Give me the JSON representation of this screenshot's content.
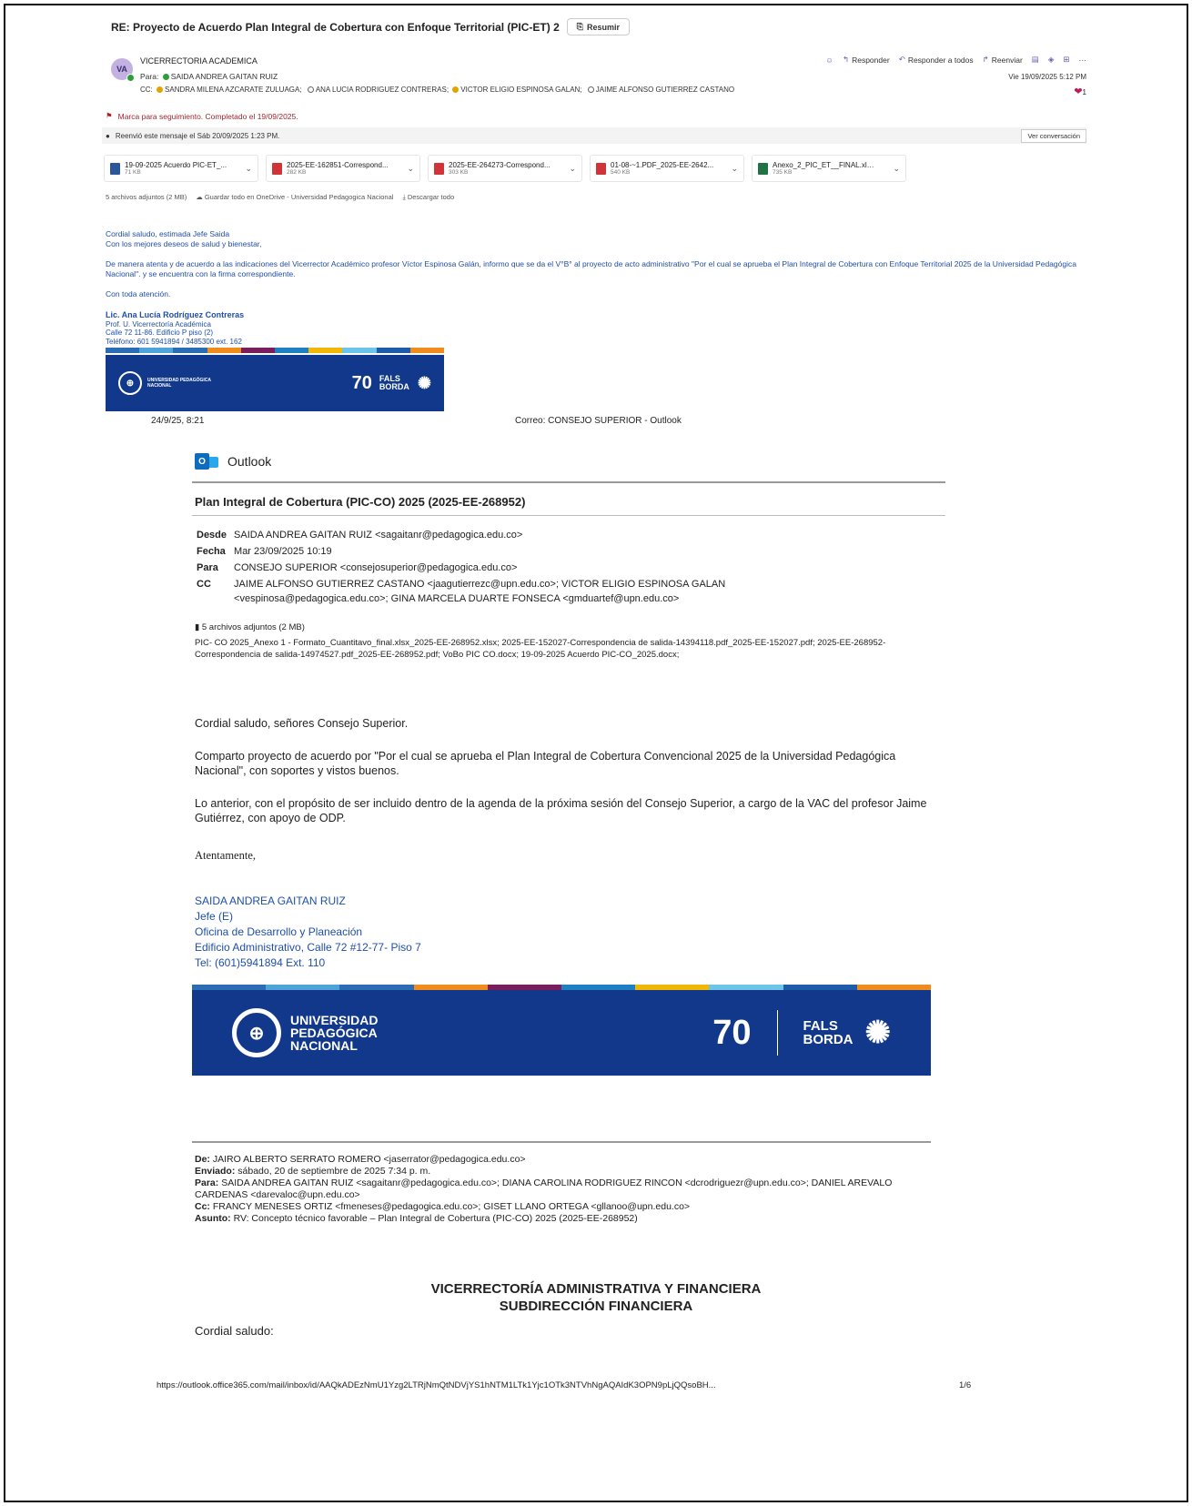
{
  "email": {
    "subject": "RE: Proyecto de Acuerdo  Plan Integral de Cobertura con Enfoque Territorial (PIC-ET) 2",
    "resumir": "Resumir",
    "avatar": "VA",
    "sender": "VICERRECTORIA ACADEMICA",
    "to_label": "Para:",
    "to": "SAIDA ANDREA GAITAN RUIZ",
    "cc_label": "CC:",
    "cc": [
      "SANDRA MILENA AZCARATE ZULUAGA;",
      "ANA LUCIA RODRIGUEZ CONTRERAS;",
      "VICTOR ELIGIO ESPINOSA GALAN;",
      "JAIME ALFONSO GUTIERREZ CASTANO"
    ],
    "actions": {
      "reply": "Responder",
      "reply_all": "Responder a todos",
      "forward": "Reenviar",
      "more": "···"
    },
    "date": "Vie 19/09/2025 5:12 PM",
    "reaction_count": "1",
    "flag_text": "Marca para seguimiento. Completado el 19/09/2025.",
    "forward_note": "Reenvió este mensaje el Sáb 20/09/2025 1:23 PM.",
    "ver_conversacion": "Ver conversación",
    "attachments": [
      {
        "name": "19-09-2025 Acuerdo PIC-ET_...",
        "size": "71 KB",
        "type": "word",
        "color": "#2b579a"
      },
      {
        "name": "2025-EE-162851-Correspond...",
        "size": "282 KB",
        "type": "pdf",
        "color": "#d13438"
      },
      {
        "name": "2025-EE-264273-Correspond...",
        "size": "303 KB",
        "type": "pdf",
        "color": "#d13438"
      },
      {
        "name": "01-08-~1.PDF_2025-EE-2642...",
        "size": "540 KB",
        "type": "pdf",
        "color": "#d13438"
      },
      {
        "name": "Anexo_2_PIC_ET__FINAL.xlsx_...",
        "size": "735 KB",
        "type": "excel",
        "color": "#217346"
      }
    ],
    "att_summary": "5 archivos adjuntos (2 MB)",
    "save_onedrive": "Guardar todo en OneDrive - Universidad Pedagogica Nacional",
    "download_all": "Descargar todo",
    "body": [
      "Cordial saludo, estimada Jefe Saida",
      "Con los mejores deseos de salud y bienestar,",
      "",
      "De manera atenta y de acuerdo a las indicaciones del Vicerrector Académico profesor Víctor Espinosa Galán, informo que se da el V°B° al proyecto de acto administrativo \"Por el cual se aprueba el Plan Integral de Cobertura con Enfoque Territorial 2025 de la Universidad Pedagógica Nacional\". y se encuentra con la firma correspondiente.",
      "",
      "Con toda atención."
    ],
    "signature": {
      "name": "Lic. Ana Lucía Rodríguez Contreras",
      "lines": [
        "Prof. U. Vicerrectoría Académica",
        "Calle 72 11-86. Edificio P piso (2)",
        "Teléfono: 601 5941894 / 3485300 ext. 162"
      ]
    },
    "banner": {
      "uni": [
        "UNIVERSIDAD PEDAGÓGICA",
        "NACIONAL"
      ],
      "seventy": "70",
      "fals": "FALS BORDA"
    }
  },
  "pdf": {
    "print_date": "24/9/25, 8:21",
    "print_title": "Correo: CONSEJO SUPERIOR - Outlook",
    "app": "Outlook",
    "title": "Plan Integral de Cobertura (PIC-CO) 2025 (2025-EE-268952)",
    "meta": {
      "desde_l": "Desde",
      "desde": "SAIDA ANDREA GAITAN RUIZ <sagaitanr@pedagogica.edu.co>",
      "fecha_l": "Fecha",
      "fecha": "Mar 23/09/2025 10:19",
      "para_l": "Para",
      "para": "CONSEJO SUPERIOR <consejosuperior@pedagogica.edu.co>",
      "cc_l": "CC",
      "cc": "JAIME ALFONSO GUTIERREZ CASTANO <jaagutierrezc@upn.edu.co>; VICTOR ELIGIO ESPINOSA GALAN <vespinosa@pedagogica.edu.co>; GINA MARCELA DUARTE FONSECA <gmduartef@upn.edu.co>"
    },
    "attach_count": "5 archivos adjuntos (2 MB)",
    "attach_list": "PIC- CO 2025_Anexo 1 - Formato_Cuantitavo_final.xlsx_2025-EE-268952.xlsx; 2025-EE-152027-Correspondencia de salida-14394118.pdf_2025-EE-152027.pdf; 2025-EE-268952-Correspondencia de salida-14974527.pdf_2025-EE-268952.pdf; VoBo PIC CO.docx; 19-09-2025 Acuerdo PIC-CO_2025.docx;",
    "body": [
      "Cordial saludo, señores Consejo Superior.",
      "Comparto proyecto de acuerdo por \"Por el cual se aprueba el Plan Integral de Cobertura Convencional 2025 de la Universidad Pedagógica Nacional\", con soportes y vistos buenos.",
      "Lo anterior, con el propósito de ser incluido dentro de la agenda de la próxima sesión del Consejo Superior, a cargo de la VAC del profesor Jaime Gutiérrez, con apoyo de ODP."
    ],
    "closing": "Atentamente,",
    "signature": [
      "SAIDA ANDREA GAITAN RUIZ",
      "Jefe (E)",
      "Oficina de Desarrollo y Planeación",
      "Edificio Administrativo, Calle 72 #12-77- Piso 7",
      "Tel: (601)5941894 Ext. 110"
    ],
    "banner": {
      "uni": [
        "UNIVERSIDAD",
        "PEDAGÓGICA",
        "NACIONAL"
      ],
      "seventy": "70",
      "fals": "FALS BORDA"
    },
    "fwd": {
      "de_l": "De:",
      "de": "JAIRO ALBERTO SERRATO ROMERO <jaserrator@pedagogica.edu.co>",
      "env_l": "Enviado:",
      "env": "sábado, 20 de septiembre de 2025 7:34 p. m.",
      "para_l": "Para:",
      "para": "SAIDA ANDREA GAITAN RUIZ <sagaitanr@pedagogica.edu.co>; DIANA CAROLINA RODRIGUEZ RINCON <dcrodriguezr@upn.edu.co>; DANIEL AREVALO CARDENAS <darevaloc@upn.edu.co>",
      "cc_l": "Cc:",
      "cc": "FRANCY MENESES ORTIZ <fmeneses@pedagogica.edu.co>; GISET LLANO ORTEGA <gllanoo@upn.edu.co>",
      "asunto_l": "Asunto:",
      "asunto": "RV: Concepto técnico favorable – Plan Integral de Cobertura (PIC-CO) 2025 (2025-EE-268952)"
    },
    "heading1": "VICERRECTORÍA ADMINISTRATIVA Y FINANCIERA",
    "heading2": "SUBDIRECCIÓN FINANCIERA",
    "cordial": "Cordial saludo:",
    "url": "https://outlook.office365.com/mail/inbox/id/AAQkADEzNmU1Yzg2LTRjNmQtNDVjYS1hNTM1LTk1Yjc1OTk3NTVhNgAQAIdK3OPN9pLjQQsoBH...",
    "page": "1/6"
  },
  "colors": {
    "strip": [
      "#2a6db5",
      "#4ea3d8",
      "#2a6db5",
      "#f08c1e",
      "#7a1e5b",
      "#1e7fc1",
      "#f2b705",
      "#6cc4e8",
      "#1e5ba8",
      "#f08c1e"
    ]
  }
}
